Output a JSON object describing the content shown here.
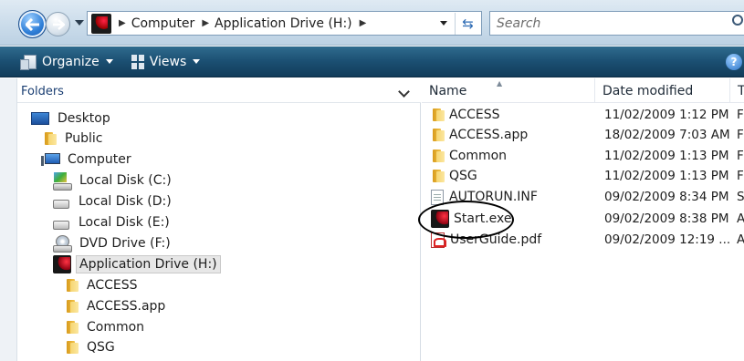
{
  "address_bar": {
    "breadcrumbs": [
      "Computer",
      "Application Drive (H:)"
    ],
    "search_placeholder": "Search"
  },
  "command_bar": {
    "organize_label": "Organize",
    "views_label": "Views",
    "help_glyph": "?"
  },
  "folders": {
    "title": "Folders",
    "items": [
      {
        "label": "Desktop",
        "icon": "desktop-icon"
      },
      {
        "label": "Public",
        "icon": "folder-icon"
      },
      {
        "label": "Computer",
        "icon": "computer-icon"
      },
      {
        "label": "Local Disk (C:)",
        "icon": "system-drive-icon"
      },
      {
        "label": "Local Disk (D:)",
        "icon": "drive-icon"
      },
      {
        "label": "Local Disk (E:)",
        "icon": "drive-icon"
      },
      {
        "label": "DVD Drive (F:)",
        "icon": "dvd-drive-icon"
      },
      {
        "label": "Application Drive (H:)",
        "icon": "application-drive-icon",
        "selected": true
      },
      {
        "label": "ACCESS",
        "icon": "folder-icon"
      },
      {
        "label": "ACCESS.app",
        "icon": "folder-icon"
      },
      {
        "label": "Common",
        "icon": "folder-icon"
      },
      {
        "label": "QSG",
        "icon": "folder-icon"
      }
    ]
  },
  "file_list": {
    "columns": [
      "Name",
      "Date modified",
      "T"
    ],
    "rows": [
      {
        "name": "ACCESS",
        "date": "11/02/2009 1:12 PM",
        "type": "F",
        "icon": "folder-icon"
      },
      {
        "name": "ACCESS.app",
        "date": "18/02/2009 7:03 AM",
        "type": "F",
        "icon": "folder-icon"
      },
      {
        "name": "Common",
        "date": "11/02/2009 1:13 PM",
        "type": "F",
        "icon": "folder-icon"
      },
      {
        "name": "QSG",
        "date": "11/02/2009 1:13 PM",
        "type": "F",
        "icon": "folder-icon"
      },
      {
        "name": "AUTORUN.INF",
        "date": "09/02/2009 8:34 PM",
        "type": "S",
        "icon": "file-icon"
      },
      {
        "name": "Start.exe",
        "date": "09/02/2009 8:38 PM",
        "type": "A",
        "icon": "application-icon",
        "circled": true
      },
      {
        "name": "UserGuide.pdf",
        "date": "09/02/2009 12:19 ...",
        "type": "A",
        "icon": "pdf-icon"
      }
    ]
  }
}
